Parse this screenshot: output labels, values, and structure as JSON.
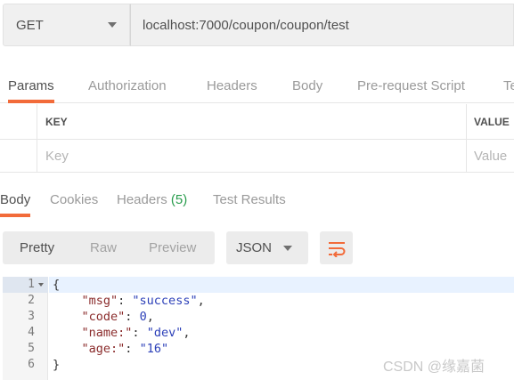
{
  "request": {
    "method": "GET",
    "url": "localhost:7000/coupon/coupon/test"
  },
  "request_tabs": [
    "Params",
    "Authorization",
    "Headers",
    "Body",
    "Pre-request Script",
    "Te"
  ],
  "params_table": {
    "columns": [
      "KEY",
      "VALUE"
    ],
    "key_placeholder": "Key",
    "value_placeholder": "Value"
  },
  "response_tabs": {
    "body": "Body",
    "cookies": "Cookies",
    "headers": "Headers",
    "headers_count": "(5)",
    "test_results": "Test Results"
  },
  "response_toolbar": {
    "views": [
      "Pretty",
      "Raw",
      "Preview"
    ],
    "format": "JSON",
    "wrap_icon": "wrap-lines-icon"
  },
  "code": {
    "line_numbers": [
      "1",
      "2",
      "3",
      "4",
      "5",
      "6"
    ],
    "lines": [
      {
        "open": "{"
      },
      {
        "key": "\"msg\"",
        "value": "\"success\"",
        "comma": ","
      },
      {
        "key": "\"code\"",
        "value": "0",
        "comma": ","
      },
      {
        "key": "\"name:\"",
        "value": "\"dev\"",
        "comma": ","
      },
      {
        "key": "\"age:\"",
        "value": "\"16\"",
        "comma": ""
      },
      {
        "close": "}"
      }
    ]
  },
  "watermark": "CSDN @缘嘉菌",
  "colors": {
    "accent": "#f26b3a",
    "count_green": "#2a9d4e",
    "json_key": "#8a2b2b",
    "json_value": "#2b3fb8"
  }
}
